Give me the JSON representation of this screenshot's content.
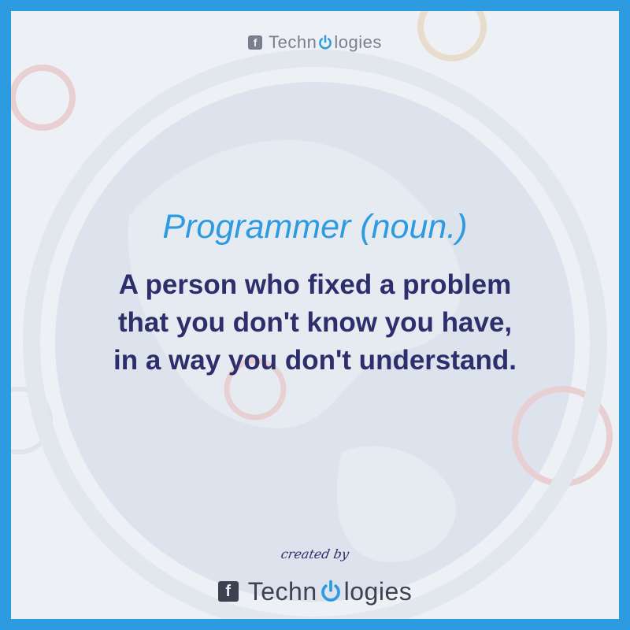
{
  "brand_top": {
    "icon": "facebook-icon",
    "name_before": "Techn",
    "name_after": "logies",
    "logo_icon": "power-icon"
  },
  "heading": "Programmer (noun.)",
  "definition": {
    "line1": "A person who fixed a problem",
    "line2": "that you don't know you have,",
    "line3": "in a way you don't understand."
  },
  "credit": "created by",
  "brand_bottom": {
    "icon": "facebook-icon",
    "name_before": "Techn",
    "name_after": "logies",
    "logo_icon": "power-icon"
  },
  "colors": {
    "frame": "#2d9be0",
    "heading": "#2d9be0",
    "definition": "#2c2f6b",
    "brand": "#3e4150",
    "background": "#edf0f5"
  }
}
